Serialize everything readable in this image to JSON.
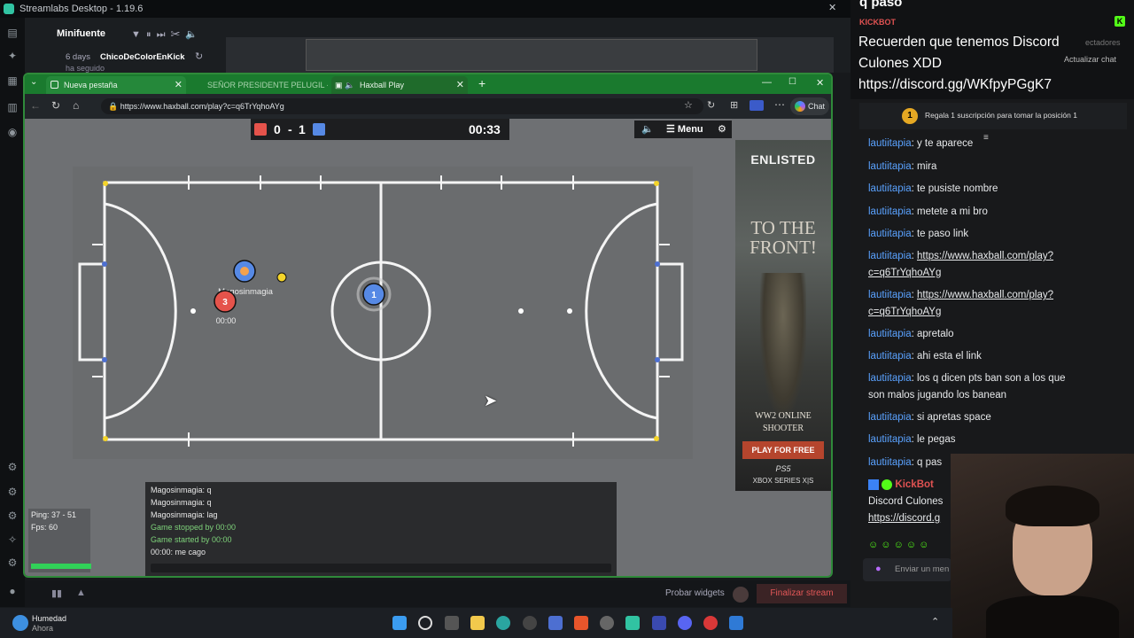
{
  "streamlabs": {
    "title": "Streamlabs Desktop - 1.19.6",
    "mini_label": "Minifuente",
    "follow_days": "6 days",
    "follow_user": "ChicoDeColorEnKick",
    "follow_note": "ha seguido",
    "probar_widgets": "Probar widgets",
    "finalizar_stream": "Finalizar stream"
  },
  "browser": {
    "tabs": [
      {
        "label": "Nueva pestaña"
      },
      {
        "label": "SEÑOR PRESIDENTE PELUGIL - Bu"
      },
      {
        "label": "Haxball Play"
      }
    ],
    "url": "https://www.haxball.com/play?c=q6TrYqhoAYg",
    "chat_button": "Chat"
  },
  "game": {
    "score_red": "0",
    "score_sep": "-",
    "score_blue": "1",
    "timer": "00:33",
    "menu_label": "Menu",
    "players": [
      {
        "number": "3",
        "team": "red"
      },
      {
        "number": "",
        "team": "blue",
        "name": "Magosinmagia"
      },
      {
        "number": "1",
        "team": "blue"
      }
    ],
    "player_timer": "00:00",
    "ping": "Ping: 37 - 51",
    "fps": "Fps: 60",
    "chat": [
      {
        "text": "Magosinmagia: q",
        "type": "msg"
      },
      {
        "text": "Magosinmagia: q",
        "type": "msg"
      },
      {
        "text": "Magosinmagia: lag",
        "type": "msg"
      },
      {
        "text": "Game stopped by 00:00",
        "type": "system"
      },
      {
        "text": "Game started by 00:00",
        "type": "system"
      },
      {
        "text": "00:00: me cago",
        "type": "msg"
      }
    ]
  },
  "ad": {
    "brand": "ENLISTED",
    "headline": "TO THE FRONT!",
    "sub1": "WW2 ONLINE",
    "sub2": "SHOOTER",
    "cta": "PLAY FOR FREE",
    "ps5": "PS5",
    "xbox": "XBOX SERIES X|S"
  },
  "stream_chat": {
    "top_partial": "q paso",
    "kickbot_label": "KICKBOT",
    "announcement": "Recuerden que tenemos Discord Culones XDD https://discord.gg/WKfpyPGgK7",
    "actualizar": "Actualizar chat",
    "espectadores": "ectadores",
    "gift_text": "Regala 1 suscripción para tomar la posición 1",
    "gift_rank": "1",
    "messages": [
      {
        "user": "lautiitapia",
        "text": ": y te aparece"
      },
      {
        "user": "lautiitapia",
        "text": ": mira"
      },
      {
        "user": "lautiitapia",
        "text": ": te pusiste nombre"
      },
      {
        "user": "lautiitapia",
        "text": ": metete a mi bro"
      },
      {
        "user": "lautiitapia",
        "text": ": te paso link"
      },
      {
        "user": "lautiitapia",
        "text": ": ",
        "link": "https://www.haxball.com/play?",
        "link2": "c=q6TrYqhoAYg"
      },
      {
        "user": "lautiitapia",
        "text": ": ",
        "link": "https://www.haxball.com/play?",
        "link2": "c=q6TrYqhoAYg"
      },
      {
        "user": "lautiitapia",
        "text": ": apretalo"
      },
      {
        "user": "lautiitapia",
        "text": ": ahi esta el link"
      },
      {
        "user": "lautiitapia",
        "text": ": los q dicen pts ban son a los que",
        "text2": "son malos jugando los banean"
      },
      {
        "user": "lautiitapia",
        "text": ": si apretas space"
      },
      {
        "user": "lautiitapia",
        "text": ": le pegas"
      },
      {
        "user": "lautiitapia",
        "text": ": q pas"
      }
    ],
    "kickbot_msg_user": "KickBot",
    "kickbot_msg_1": "Discord Culones",
    "kickbot_msg_2": "https://discord.g",
    "input_placeholder": "Enviar un men"
  },
  "taskbar": {
    "weather_title": "Humedad",
    "weather_sub": "Ahora"
  },
  "colors": {
    "browser_green": "#1a7a2e",
    "red_team": "#e5534b",
    "blue_team": "#5689e5",
    "ball": "#f5d52a",
    "chat_user": "#5aa2ff",
    "kick_green": "#53fc18"
  }
}
